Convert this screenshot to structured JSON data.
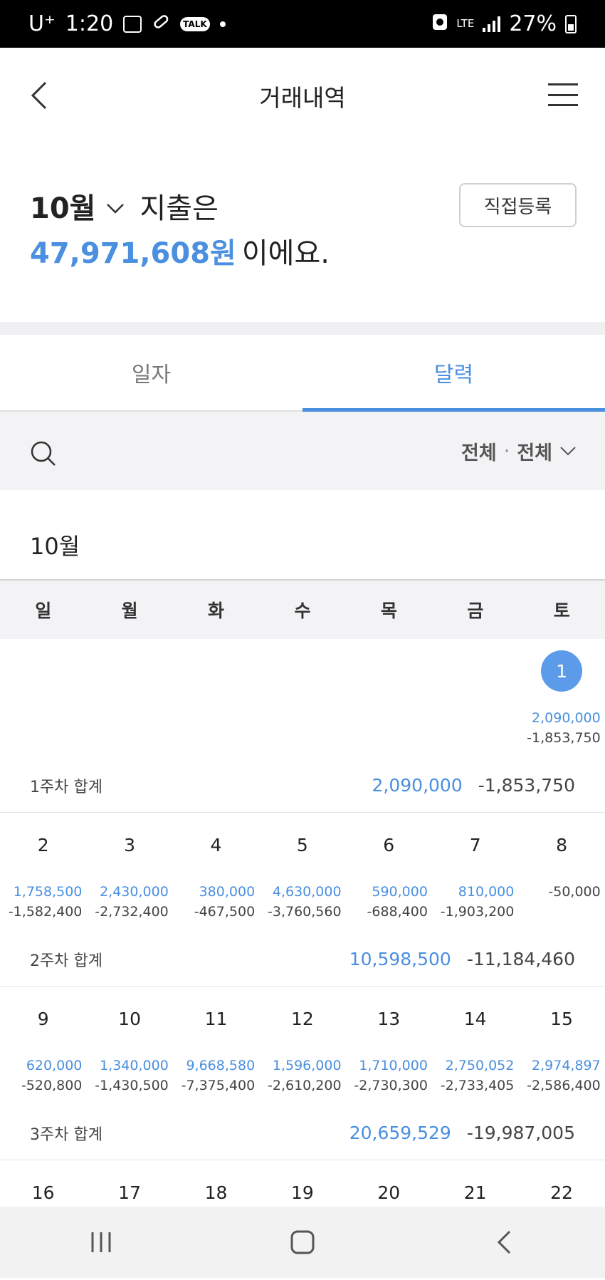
{
  "status_bar": {
    "carrier": "U⁺",
    "time": "1:20",
    "network": "LTE",
    "battery": "27%"
  },
  "header": {
    "title": "거래내역"
  },
  "summary": {
    "month": "10월",
    "line1_suffix": "지출은",
    "amount": "47,971,608원",
    "amount_suffix": "이에요.",
    "register_button": "직접등록"
  },
  "tabs": [
    {
      "label": "일자",
      "active": false
    },
    {
      "label": "달력",
      "active": true
    }
  ],
  "filter": {
    "option1": "전체",
    "separator": "·",
    "option2": "전체"
  },
  "calendar": {
    "month_label": "10월",
    "weekdays": [
      "일",
      "월",
      "화",
      "수",
      "목",
      "금",
      "토"
    ],
    "weeks": [
      {
        "days": [
          {
            "num": "",
            "in": "",
            "out": ""
          },
          {
            "num": "",
            "in": "",
            "out": ""
          },
          {
            "num": "",
            "in": "",
            "out": ""
          },
          {
            "num": "",
            "in": "",
            "out": ""
          },
          {
            "num": "",
            "in": "",
            "out": ""
          },
          {
            "num": "",
            "in": "",
            "out": ""
          },
          {
            "num": "1",
            "in": "2,090,000",
            "out": "-1,853,750",
            "selected": true
          }
        ],
        "sum_label": "1주차 합계",
        "sum_in": "2,090,000",
        "sum_out": "-1,853,750"
      },
      {
        "days": [
          {
            "num": "2",
            "in": "1,758,500",
            "out": "-1,582,400"
          },
          {
            "num": "3",
            "in": "2,430,000",
            "out": "-2,732,400"
          },
          {
            "num": "4",
            "in": "380,000",
            "out": "-467,500"
          },
          {
            "num": "5",
            "in": "4,630,000",
            "out": "-3,760,560"
          },
          {
            "num": "6",
            "in": "590,000",
            "out": "-688,400"
          },
          {
            "num": "7",
            "in": "810,000",
            "out": "-1,903,200"
          },
          {
            "num": "8",
            "in": "",
            "out": "-50,000"
          }
        ],
        "sum_label": "2주차 합계",
        "sum_in": "10,598,500",
        "sum_out": "-11,184,460"
      },
      {
        "days": [
          {
            "num": "9",
            "in": "620,000",
            "out": "-520,800"
          },
          {
            "num": "10",
            "in": "1,340,000",
            "out": "-1,430,500"
          },
          {
            "num": "11",
            "in": "9,668,580",
            "out": "-7,375,400"
          },
          {
            "num": "12",
            "in": "1,596,000",
            "out": "-2,610,200"
          },
          {
            "num": "13",
            "in": "1,710,000",
            "out": "-2,730,300"
          },
          {
            "num": "14",
            "in": "2,750,052",
            "out": "-2,733,405"
          },
          {
            "num": "15",
            "in": "2,974,897",
            "out": "-2,586,400"
          }
        ],
        "sum_label": "3주차 합계",
        "sum_in": "20,659,529",
        "sum_out": "-19,987,005"
      },
      {
        "days": [
          {
            "num": "16",
            "in": "",
            "out": ""
          },
          {
            "num": "17",
            "in": "",
            "out": ""
          },
          {
            "num": "18",
            "in": "",
            "out": ""
          },
          {
            "num": "19",
            "in": "",
            "out": ""
          },
          {
            "num": "20",
            "in": "",
            "out": ""
          },
          {
            "num": "21",
            "in": "",
            "out": ""
          },
          {
            "num": "22",
            "in": "",
            "out": ""
          }
        ]
      }
    ]
  },
  "colors": {
    "accent": "#4a8fe0",
    "selected_day": "#5b9bea"
  }
}
